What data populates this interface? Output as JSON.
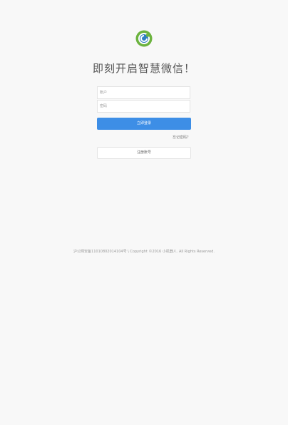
{
  "logo": {
    "icon": "app-logo-icon",
    "colors": {
      "ring": "#6cb33f",
      "center": "#2f7fc1"
    }
  },
  "headline": "即刻开启智慧微信！",
  "form": {
    "username_placeholder": "账户",
    "password_placeholder": "密码",
    "submit_label": "立即登录",
    "forgot_label": "忘记密码？",
    "register_label": "注册账号"
  },
  "footer": {
    "text": "沪公网安备11010802014104号 \\ Copyright ©2016 小机器人. All Rights Reserved."
  },
  "colors": {
    "accent": "#3d8ee6",
    "background": "#f8f8f8"
  }
}
